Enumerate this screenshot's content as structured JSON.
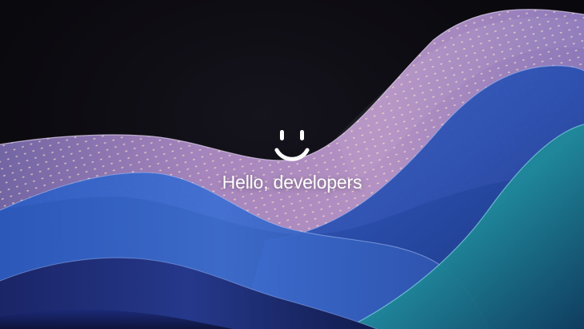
{
  "greeting": {
    "text": "Hello, developers"
  },
  "logo": {
    "icon": "smiley-face-icon",
    "color": "#ffffff"
  },
  "palette": {
    "background": "#0b0a0f",
    "wave_lilac": "#b48ccf",
    "wave_blue": "#2f57b8",
    "wave_teal": "#1f8a9a",
    "wave_navy": "#182a6a"
  }
}
